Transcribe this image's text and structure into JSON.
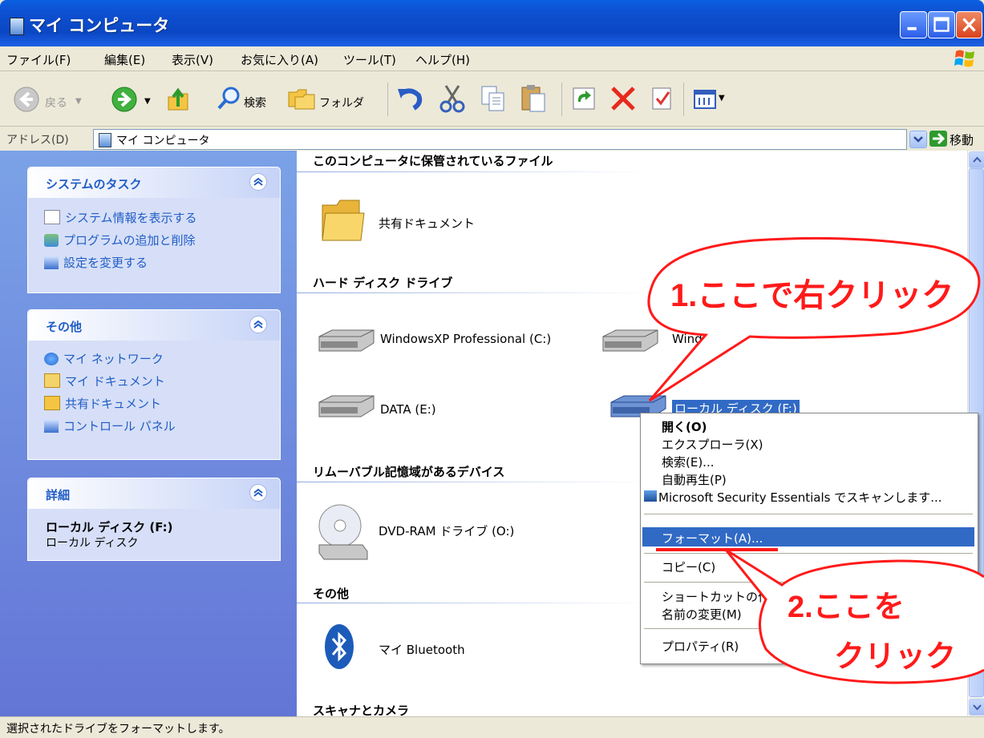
{
  "window": {
    "title": "マイ コンピュータ"
  },
  "menubar": {
    "items": [
      "ファイル(F)",
      "編集(E)",
      "表示(V)",
      "お気に入り(A)",
      "ツール(T)",
      "ヘルプ(H)"
    ]
  },
  "toolbar": {
    "back_label": "戻る",
    "search_label": "検索",
    "folders_label": "フォルダ"
  },
  "address": {
    "label": "アドレス(D)",
    "value": "マイ コンピュータ",
    "go_label": "移動"
  },
  "tasks": {
    "system": {
      "title": "システムのタスク",
      "items": [
        "システム情報を表示する",
        "プログラムの追加と削除",
        "設定を変更する"
      ]
    },
    "other": {
      "title": "その他",
      "items": [
        "マイ ネットワーク",
        "マイ ドキュメント",
        "共有ドキュメント",
        "コントロール パネル"
      ]
    },
    "details": {
      "title": "詳細",
      "name": "ローカル ディスク (F:)",
      "type": "ローカル ディスク"
    }
  },
  "groups": {
    "stored": {
      "title": "このコンピュータに保管されているファイル",
      "items": [
        "共有ドキュメント"
      ]
    },
    "hdd": {
      "title": "ハード ディスク ドライブ",
      "items": [
        "WindowsXP Professional (C:)",
        "Wind",
        "DATA (E:)",
        "ローカル ディスク (F:)"
      ]
    },
    "removable": {
      "title": "リムーバブル記憶域があるデバイス",
      "items": [
        "DVD-RAM ドライブ (O:)"
      ]
    },
    "other": {
      "title": "その他",
      "items": [
        "マイ Bluetooth"
      ]
    },
    "scanners": {
      "title": "スキャナとカメラ"
    }
  },
  "context_menu": {
    "items": [
      "開く(O)",
      "エクスプローラ(X)",
      "検索(E)...",
      "自動再生(P)",
      "Microsoft Security Essentials でスキャンします...",
      "フォーマット(A)...",
      "コピー(C)",
      "ショートカットの作成",
      "名前の変更(M)",
      "プロパティ(R)"
    ],
    "selected": "フォーマット(A)..."
  },
  "annotations": {
    "step1": "1.ここで右クリック",
    "step2_line1": "2.ここを",
    "step2_line2": "クリック",
    "color": "#ff1a1a"
  },
  "status": {
    "text": "選択されたドライブをフォーマットします。"
  },
  "colors": {
    "titlebar": "#0b47c4",
    "taskpane": "#6375d6",
    "selection": "#316ac5"
  }
}
